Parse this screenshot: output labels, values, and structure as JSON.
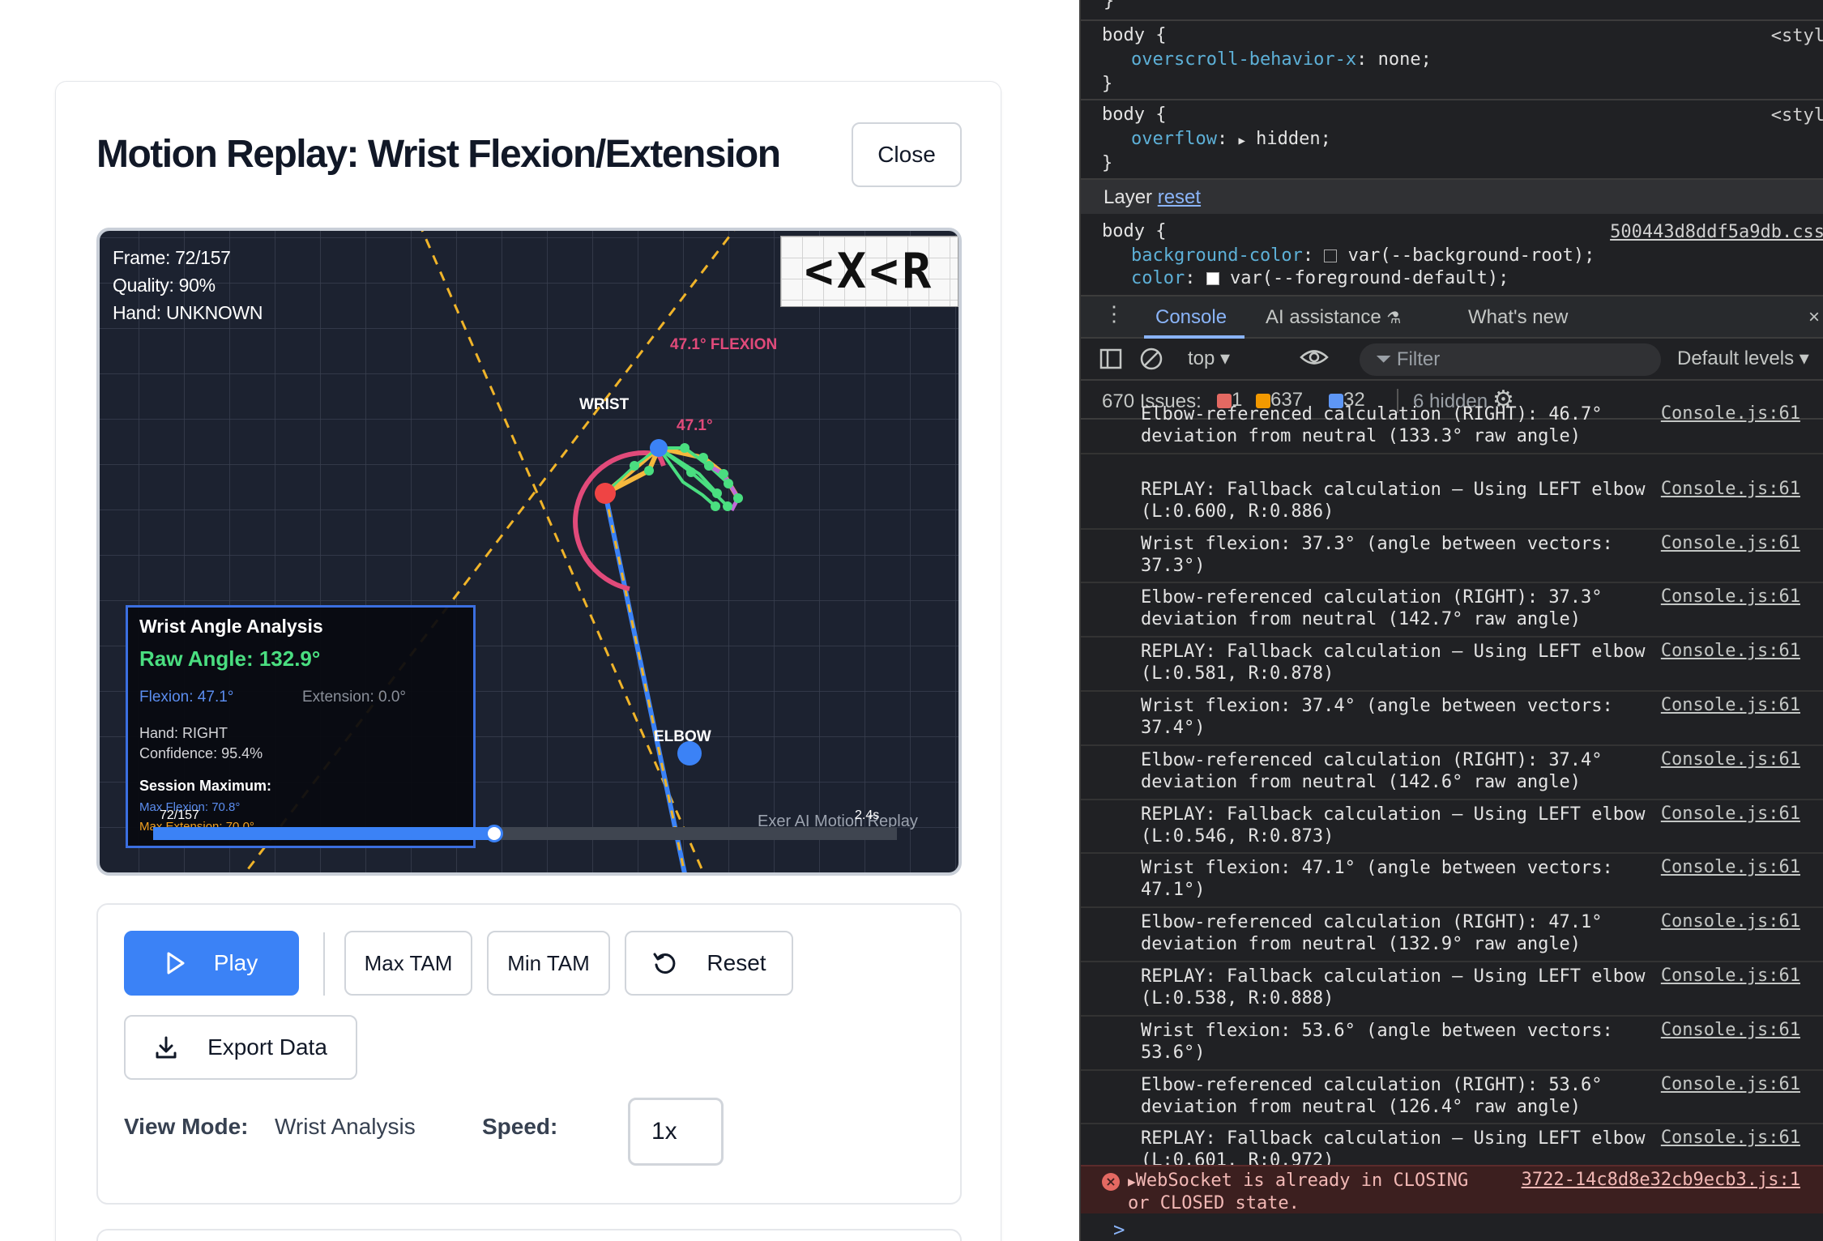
{
  "modal": {
    "title": "Motion Replay: Wrist Flexion/Extension",
    "close_label": "Close"
  },
  "viz": {
    "frame_text": "Frame: 72/157",
    "quality_text": "Quality: 90%",
    "hand_text": "Hand: UNKNOWN",
    "logo_text": "<X<R",
    "wrist_label": "WRIST",
    "elbow_label": "ELBOW",
    "flexion_label": "47.1° FLEXION",
    "angle_label": "47.1°",
    "analysis": {
      "title": "Wrist Angle Analysis",
      "raw_angle": "Raw Angle: 132.9°",
      "flexion": "Flexion: 47.1°",
      "extension": "Extension: 0.0°",
      "hand": "Hand: RIGHT",
      "confidence": "Confidence: 95.4%",
      "session_title": "Session Maximum:",
      "max_flexion": "Max Flexion: 70.8°",
      "max_extension": "Max Extension: 70.0°"
    },
    "timeline": {
      "frame": "72/157",
      "time": "2.4s",
      "progress": 0.4586
    },
    "watermark": "Exer AI Motion Replay",
    "colors": {
      "flexion": "#e14a7a",
      "wrist_point": "#ef4444",
      "elbow_point": "#3b82f6",
      "finger": "#4ade80",
      "thumb": "#f5b83d",
      "guide_line": "#f0b429"
    }
  },
  "controls": {
    "play": "Play",
    "max_tam": "Max TAM",
    "min_tam": "Min TAM",
    "reset": "Reset",
    "export": "Export Data",
    "view_mode_label": "View Mode:",
    "view_mode_value": "Wrist Analysis",
    "speed_label": "Speed:",
    "speed_value": "1x"
  },
  "devtools": {
    "styles": {
      "rule1_selector": "body {",
      "rule1_prop": "overscroll-behavior-x",
      "rule1_value": "none;",
      "rule1_source": "<styl",
      "rule2_selector": "body {",
      "rule2_prop": "overflow",
      "rule2_value": "hidden;",
      "rule2_source": "<styl",
      "layer_label": "Layer",
      "layer_link": "reset",
      "rule3_selector": "body {",
      "rule3_source": "500443d8ddf5a9db.css",
      "rule3_prop1": "background-color",
      "rule3_value1": "var(--background-root);",
      "rule3_prop2": "color",
      "rule3_value2": "var(--foreground-default);",
      "brace": "}"
    },
    "tabs": {
      "console": "Console",
      "ai": "AI assistance",
      "whats_new": "What's new"
    },
    "toolbar": {
      "context": "top",
      "filter_placeholder": "Filter",
      "levels": "Default levels"
    },
    "issues": {
      "label": "670 Issues:",
      "errors": "1",
      "warnings": "637",
      "info": "32",
      "hidden": "6 hidden"
    },
    "logs": [
      {
        "text": "Elbow-referenced calculation (RIGHT): 46.7°\ndeviation from neutral (133.3° raw angle)",
        "source": "Console.js:61"
      },
      {
        "text": "REPLAY: Fallback calculation – Using LEFT elbow\n(L:0.600, R:0.886)",
        "source": "Console.js:61"
      },
      {
        "text": "Wrist flexion: 37.3° (angle between vectors:\n37.3°)",
        "source": "Console.js:61"
      },
      {
        "text": "Elbow-referenced calculation (RIGHT): 37.3°\ndeviation from neutral (142.7° raw angle)",
        "source": "Console.js:61"
      },
      {
        "text": "REPLAY: Fallback calculation – Using LEFT elbow\n(L:0.581, R:0.878)",
        "source": "Console.js:61"
      },
      {
        "text": "Wrist flexion: 37.4° (angle between vectors:\n37.4°)",
        "source": "Console.js:61"
      },
      {
        "text": "Elbow-referenced calculation (RIGHT): 37.4°\ndeviation from neutral (142.6° raw angle)",
        "source": "Console.js:61"
      },
      {
        "text": "REPLAY: Fallback calculation – Using LEFT elbow\n(L:0.546, R:0.873)",
        "source": "Console.js:61"
      },
      {
        "text": "Wrist flexion: 47.1° (angle between vectors:\n47.1°)",
        "source": "Console.js:61"
      },
      {
        "text": "Elbow-referenced calculation (RIGHT): 47.1°\ndeviation from neutral (132.9° raw angle)",
        "source": "Console.js:61"
      },
      {
        "text": "REPLAY: Fallback calculation – Using LEFT elbow\n(L:0.538, R:0.888)",
        "source": "Console.js:61"
      },
      {
        "text": "Wrist flexion: 53.6° (angle between vectors:\n53.6°)",
        "source": "Console.js:61"
      },
      {
        "text": "Elbow-referenced calculation (RIGHT): 53.6°\ndeviation from neutral (126.4° raw angle)",
        "source": "Console.js:61"
      },
      {
        "text": "REPLAY: Fallback calculation – Using LEFT elbow\n(L:0.601, R:0.972)",
        "source": "Console.js:61"
      }
    ],
    "error": {
      "text": "WebSocket is already in CLOSING\nor CLOSED state.",
      "source": "3722-14c8d8e32cb9ecb3.js:1"
    },
    "prompt": ">"
  }
}
